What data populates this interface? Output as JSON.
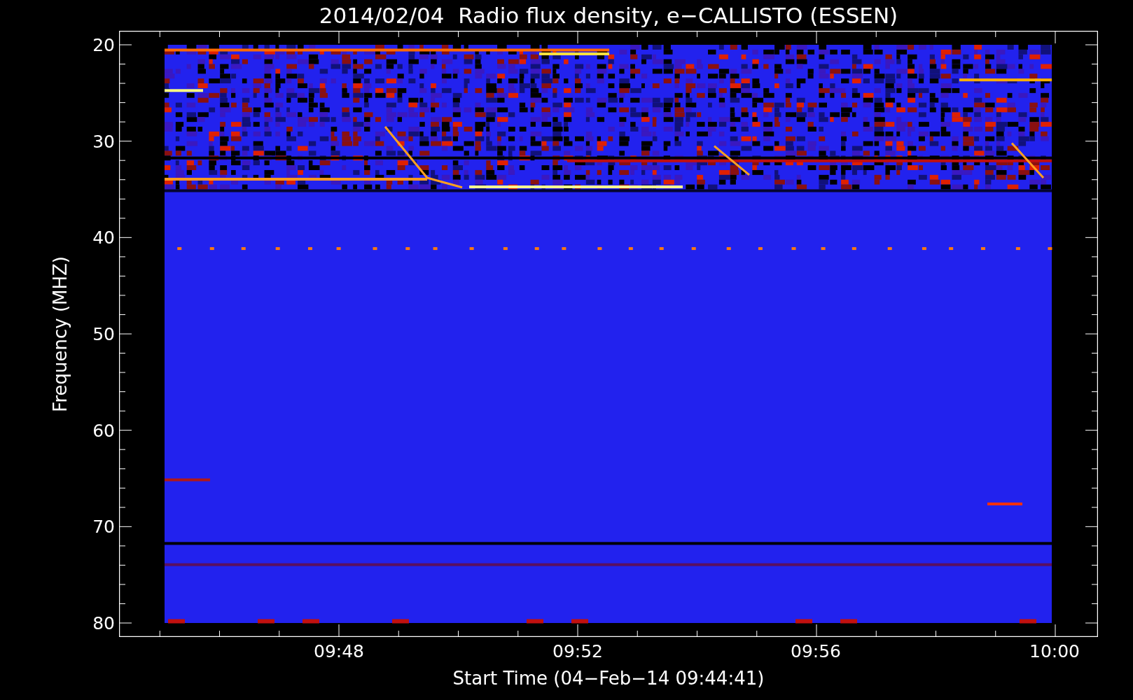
{
  "title": "2014/02/04  Radio flux density, e−CALLISTO (ESSEN)",
  "y_axis": {
    "label": "Frequency (MHZ)",
    "ticks": [
      "20",
      "30",
      "40",
      "50",
      "60",
      "70",
      "80"
    ]
  },
  "x_axis": {
    "label": "Start Time (04−Feb−14 09:44:41)",
    "ticks": [
      "09:48",
      "09:52",
      "09:56",
      "10:00"
    ]
  }
}
